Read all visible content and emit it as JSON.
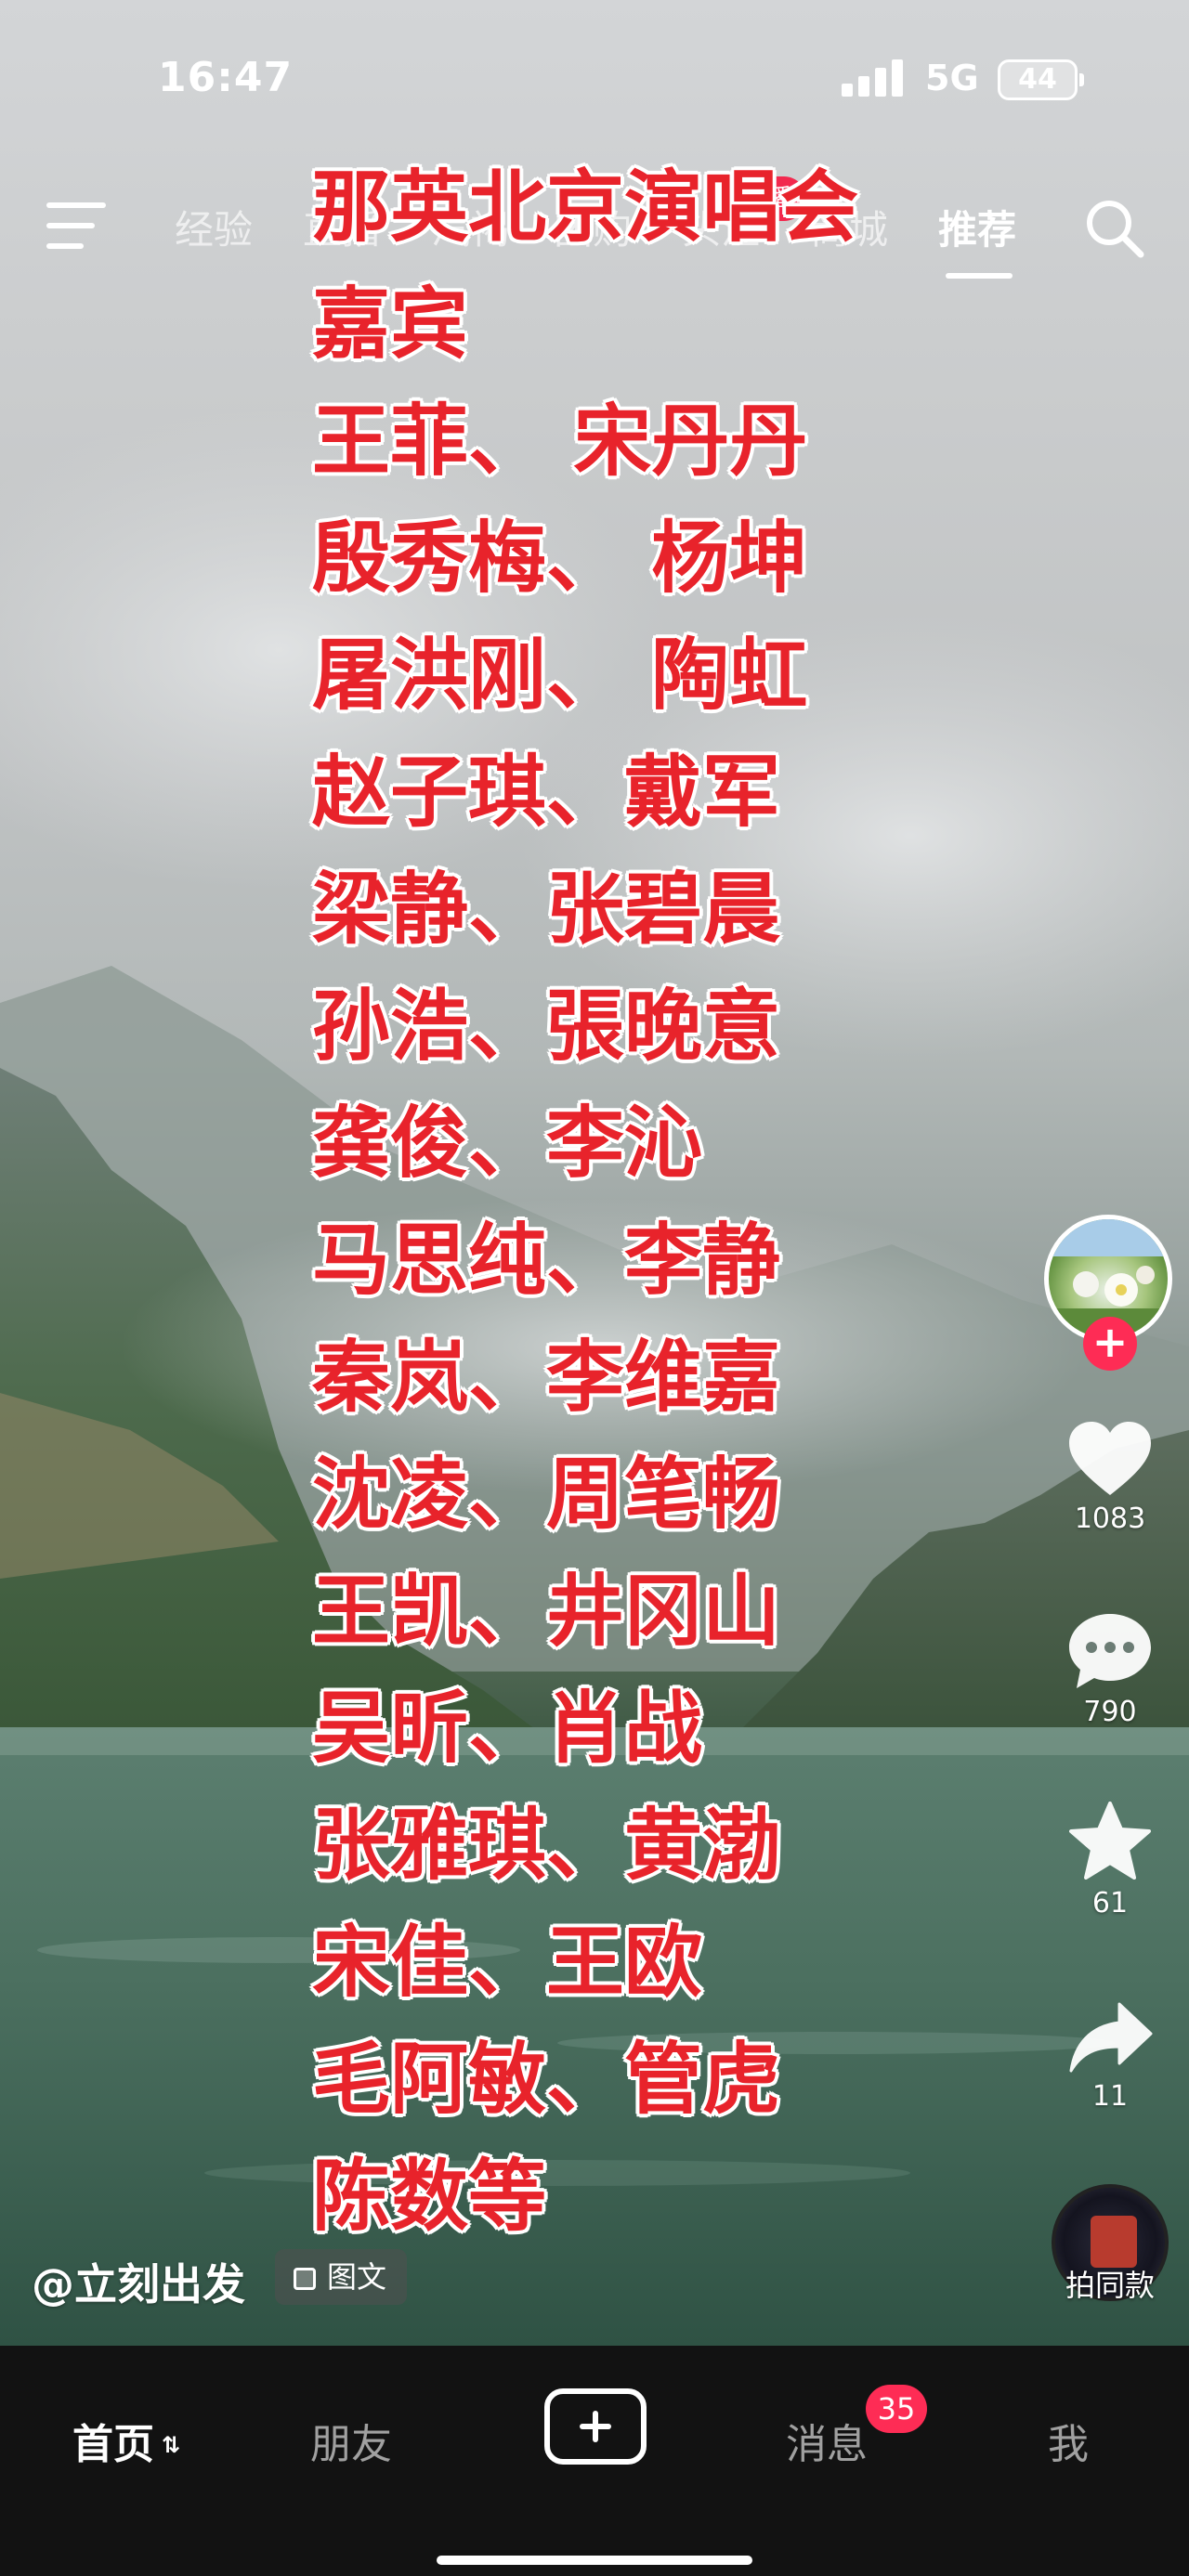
{
  "status_bar": {
    "time": "16:47",
    "network": "5G",
    "battery": "44"
  },
  "top_nav": {
    "tabs": [
      "经验",
      "直播",
      "汽褐",
      "团购",
      "头注",
      "商城",
      "推荐"
    ],
    "active_tab": "推荐",
    "live_badge": "直播"
  },
  "poster": {
    "title": "那英北京演唱会",
    "guest_label": "嘉宾",
    "guests": [
      "王菲、 宋丹丹",
      "殷秀梅、 杨坤",
      "屠洪刚、 陶虹",
      "赵子琪、戴军",
      "梁静、张碧晨",
      "孙浩、張晚意",
      "龚俊、李沁",
      "马思纯、李静",
      "秦岚、李维嘉",
      "沈凌、周笔畅",
      "王凯、井冈山",
      "吴昕、肖战",
      "张雅琪、黄渤",
      "宋佳、王欧",
      "毛阿敏、管虎",
      "陈数等"
    ]
  },
  "rail": {
    "like_count": "1083",
    "comment_count": "790",
    "favorite_count": "61",
    "share_count": "11",
    "same_style_label": "拍同款",
    "like_icon": "heart-icon",
    "comment_icon": "comment-icon",
    "favorite_icon": "star-icon",
    "share_icon": "share-icon"
  },
  "author": {
    "handle": "@立刻出发",
    "tag": "图文"
  },
  "tab_bar": {
    "home": "首页",
    "friends": "朋友",
    "messages": "消息",
    "messages_badge": "35",
    "me": "我"
  }
}
